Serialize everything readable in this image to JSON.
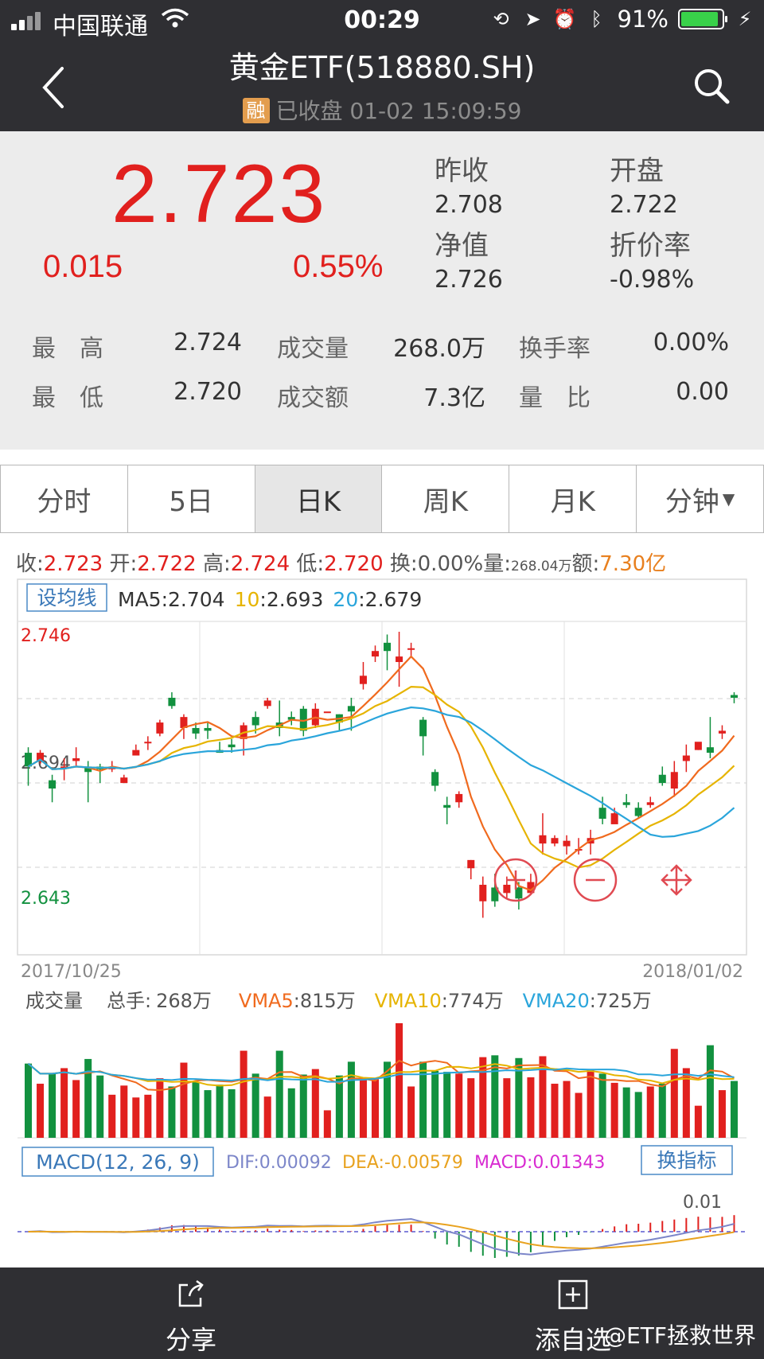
{
  "status_bar": {
    "carrier": "中国联通",
    "time": "00:29",
    "battery": "91%",
    "battery_level": 0.91
  },
  "nav": {
    "title": "黄金ETF(518880.SH)",
    "badge": "融",
    "status": "已收盘 01-02 15:09:59"
  },
  "quote": {
    "price": "2.723",
    "change": "0.015",
    "change_pct": "0.55%",
    "prev_close_label": "昨收",
    "prev_close": "2.708",
    "open_label": "开盘",
    "open": "2.722",
    "nav_label": "净值",
    "nav": "2.726",
    "discount_label": "折价率",
    "discount": "-0.98%",
    "stats": [
      {
        "l1": "最　高",
        "v1": "2.724",
        "l2": "成交量",
        "v2": "268.0万",
        "l3": "换手率",
        "v3": "0.00%"
      },
      {
        "l1": "最　低",
        "v1": "2.720",
        "l2": "成交额",
        "v2": "7.3亿",
        "l3": "量　比",
        "v3": "0.00"
      }
    ]
  },
  "tabs": [
    "分时",
    "5日",
    "日K",
    "周K",
    "月K",
    "分钟"
  ],
  "active_tab": "日K",
  "ohlc": {
    "close_label": "收:",
    "close": "2.723",
    "open_label": "开:",
    "open": "2.722",
    "high_label": "高:",
    "high": "2.724",
    "low_label": "低:",
    "low": "2.720",
    "turnover_label": "换:",
    "turnover": "0.00%",
    "volume_label": "量:",
    "volume": "268.04万",
    "amount_label": "额:",
    "amount": "7.30亿"
  },
  "ma_bar": {
    "button": "设均线",
    "ma5_label": "MA5",
    "ma5": "2.704",
    "ma10_label": "10",
    "ma10": "2.693",
    "ma20_label": "20",
    "ma20": "2.679"
  },
  "price_axis": {
    "top": "2.746",
    "mid": "2.694",
    "bottom": "2.643"
  },
  "date_range": {
    "start": "2017/10/25",
    "end": "2018/01/02"
  },
  "volume_bar": {
    "title": "成交量",
    "total_label": "总手:",
    "total": "268万",
    "vma5_label": "VMA5",
    "vma5": "815万",
    "vma10_label": "VMA10",
    "vma10": "774万",
    "vma20_label": "VMA20",
    "vma20": "725万"
  },
  "macd_bar": {
    "title": "MACD(12, 26, 9)",
    "dif": "DIF:0.00092",
    "dea": "DEA:-0.00579",
    "macd": "MACD:0.01343",
    "switch": "换指标",
    "axis_label": "0.01"
  },
  "colors": {
    "up": "#e1201e",
    "down": "#12913f",
    "ma5": "#f06a1e",
    "ma10": "#e6b400",
    "ma20": "#2aa5db",
    "header": "#2f2f33"
  },
  "bottom_bar": {
    "share": "分享",
    "add": "添自选",
    "watermark": "@ETF拯救世界"
  },
  "chart_data": {
    "type": "candlestick",
    "title": "黄金ETF(518880.SH) 日K",
    "x_start": "2017/10/25",
    "x_end": "2018/01/02",
    "ylim": [
      2.643,
      2.746
    ],
    "candles": [
      [
        2.702,
        2.697,
        2.704,
        2.69
      ],
      [
        2.699,
        2.702,
        2.703,
        2.698
      ],
      [
        2.692,
        2.689,
        2.694,
        2.684
      ],
      [
        2.697,
        2.697,
        2.7,
        2.692
      ],
      [
        2.699,
        2.7,
        2.704,
        2.697
      ],
      [
        2.697,
        2.695,
        2.699,
        2.684
      ],
      [
        2.697,
        2.696,
        2.698,
        2.691
      ],
      [
        2.696,
        2.697,
        2.699,
        2.695
      ],
      [
        2.691,
        2.693,
        2.694,
        2.691
      ],
      [
        2.701,
        2.703,
        2.705,
        2.703
      ],
      [
        2.706,
        2.706,
        2.708,
        2.703
      ],
      [
        2.709,
        2.713,
        2.714,
        2.708
      ],
      [
        2.722,
        2.719,
        2.724,
        2.718
      ],
      [
        2.711,
        2.715,
        2.716,
        2.707
      ],
      [
        2.711,
        2.709,
        2.713,
        2.707
      ],
      [
        2.711,
        2.71,
        2.713,
        2.707
      ],
      [
        2.703,
        2.702,
        2.706,
        2.702
      ],
      [
        2.705,
        2.704,
        2.707,
        2.702
      ],
      [
        2.707,
        2.712,
        2.713,
        2.701
      ],
      [
        2.715,
        2.712,
        2.717,
        2.709
      ],
      [
        2.719,
        2.721,
        2.722,
        2.718
      ],
      [
        2.713,
        2.711,
        2.721,
        2.708
      ],
      [
        2.715,
        2.714,
        2.717,
        2.712
      ],
      [
        2.718,
        2.71,
        2.719,
        2.708
      ],
      [
        2.712,
        2.718,
        2.72,
        2.711
      ],
      [
        2.717,
        2.717,
        2.717,
        2.717
      ],
      [
        2.716,
        2.713,
        2.716,
        2.71
      ],
      [
        2.719,
        2.717,
        2.722,
        2.71
      ],
      [
        2.727,
        2.73,
        2.735,
        2.725
      ],
      [
        2.737,
        2.739,
        2.741,
        2.735
      ],
      [
        2.742,
        2.739,
        2.745,
        2.732
      ],
      [
        2.735,
        2.737,
        2.746,
        2.726
      ],
      [
        2.74,
        2.74,
        2.742,
        2.737
      ],
      [
        2.714,
        2.708,
        2.715,
        2.701
      ],
      [
        2.695,
        2.69,
        2.696,
        2.688
      ],
      [
        2.683,
        2.682,
        2.686,
        2.676
      ],
      [
        2.684,
        2.687,
        2.688,
        2.682
      ],
      [
        2.66,
        2.663,
        2.663,
        2.656
      ],
      [
        2.648,
        2.654,
        2.657,
        2.642
      ],
      [
        2.653,
        2.648,
        2.658,
        2.646
      ],
      [
        2.651,
        2.654,
        2.657,
        2.649
      ],
      [
        2.653,
        2.649,
        2.655,
        2.645
      ],
      [
        2.651,
        2.655,
        2.658,
        2.651
      ],
      [
        2.669,
        2.672,
        2.68,
        2.665
      ],
      [
        2.669,
        2.671,
        2.672,
        2.668
      ],
      [
        2.668,
        2.67,
        2.672,
        2.665
      ],
      [
        2.667,
        2.667,
        2.671,
        2.665
      ],
      [
        2.669,
        2.671,
        2.674,
        2.665
      ],
      [
        2.682,
        2.678,
        2.686,
        2.676
      ],
      [
        2.676,
        2.68,
        2.682,
        2.678
      ],
      [
        2.684,
        2.683,
        2.687,
        2.682
      ],
      [
        2.682,
        2.679,
        2.684,
        2.678
      ],
      [
        2.683,
        2.684,
        2.686,
        2.682
      ],
      [
        2.694,
        2.691,
        2.697,
        2.69
      ],
      [
        2.689,
        2.695,
        2.699,
        2.686
      ],
      [
        2.699,
        2.701,
        2.705,
        2.695
      ],
      [
        2.703,
        2.706,
        2.705,
        2.703
      ],
      [
        2.704,
        2.702,
        2.715,
        2.7
      ],
      [
        2.709,
        2.71,
        2.712,
        2.707
      ],
      [
        2.723,
        2.722,
        2.724,
        2.72
      ]
    ],
    "volume": [],
    "series": [
      {
        "name": "MA5"
      },
      {
        "name": "10"
      },
      {
        "name": "20"
      }
    ]
  }
}
